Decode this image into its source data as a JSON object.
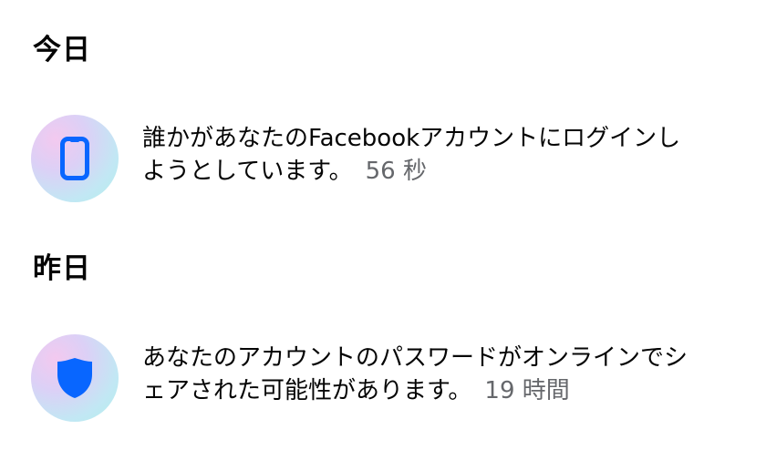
{
  "sections": [
    {
      "title": "今日",
      "notification": {
        "icon": "smartphone-icon",
        "line1": "誰かがあなたのFacebookアカウントにログインし",
        "line2": "ようとしています。",
        "time": "56 秒"
      }
    },
    {
      "title": "昨日",
      "notification": {
        "icon": "shield-icon",
        "line1": "あなたのアカウントのパスワードがオンラインでシ",
        "line2": "ェアされた可能性があります。",
        "time": "19 時間"
      }
    }
  ],
  "colors": {
    "icon_blue": "#0866ff",
    "time_gray": "#65676b",
    "text": "#050505"
  }
}
